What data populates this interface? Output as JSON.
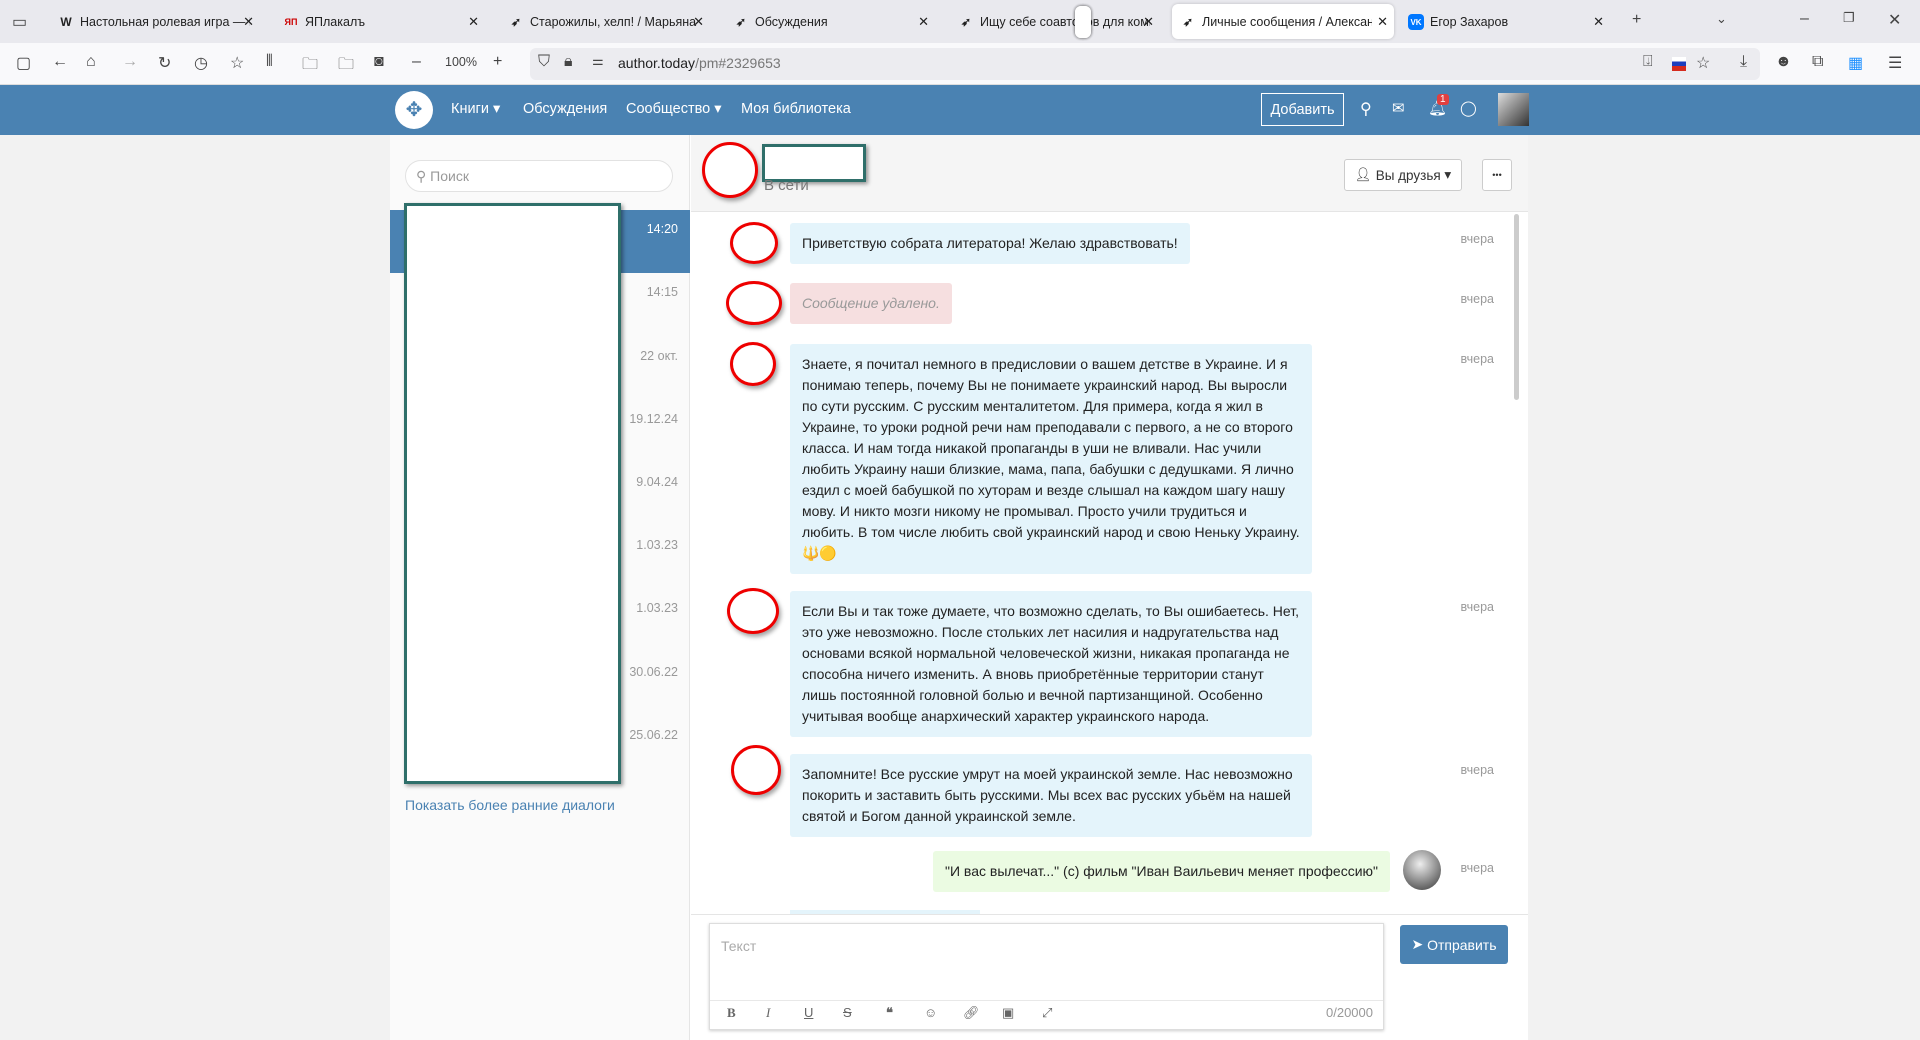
{
  "browser": {
    "tabs": [
      {
        "label": "Настольная ролевая игра — Ві",
        "icon": "W"
      },
      {
        "label": "ЯПлакалъ",
        "icon": "ЯП"
      },
      {
        "label": "Старожилы, хелп! / Марьяна Н",
        "icon": "AT"
      },
      {
        "label": "Обсуждения",
        "icon": "AT"
      },
      {
        "label": "Ищу себе соавторов для коми",
        "icon": "AT"
      },
      {
        "label": "Личные сообщения / Алексан",
        "icon": "AT"
      },
      {
        "label": "Егор Захаров",
        "icon": "VK"
      }
    ],
    "zoom": "100%",
    "url_host": "author.today",
    "url_path": "/pm#2329653"
  },
  "site": {
    "nav": [
      "Книги",
      "Обсуждения",
      "Сообщество",
      "Моя библиотека"
    ],
    "add_label": "Добавить",
    "notif_count": "1"
  },
  "sidebar": {
    "search_placeholder": "Поиск",
    "dialog_times": [
      "14:20",
      "14:15",
      "22 окт.",
      "19.12.24",
      "9.04.24",
      "1.03.23",
      "1.03.23",
      "30.06.22",
      "25.06.22"
    ],
    "show_more": "Показать более ранние диалоги"
  },
  "chat": {
    "status": "В сети",
    "friends_label": "Вы друзья",
    "more_label": "•••",
    "messages": [
      {
        "text": "Приветствую собрата литератора! Желаю здравствовать!",
        "time": "вчера"
      },
      {
        "text": "Сообщение удалено.",
        "time": "вчера"
      },
      {
        "text": "Знаете, я почитал немного в предисловии о вашем детстве в Украине. И я понимаю теперь, почему Вы не понимаете украинский народ. Вы выросли по сути русским. С русским менталитетом. Для примера, когда я жил в Украине, то уроки родной речи нам преподавали с первого, а не со второго класса. И нам тогда никакой пропаганды в уши не вливали. Нас учили любить Украину наши близкие, мама, папа, бабушки с дедушками. Я лично ездил с моей бабушкой по хуторам и везде слышал на каждом шагу нашу мову. И никто мозги никому не промывал. Просто учили трудиться и любить. В том числе любить свой украинский народ и свою Неньку Украину. 🔱🟡",
        "time": "вчера"
      },
      {
        "text": "Если Вы и так тоже думаете, что возможно сделать, то Вы ошибаетесь. Нет, это уже невозможно. После стольких лет насилия и надругательства над основами всякой нормальной человеческой жизни, никакая пропаганда не способна ничего изменить. А вновь приобретённые территории станут лишь постоянной головной болью и вечной партизанщиной. Особенно учитывая вообще анархический характер украинского народа.",
        "time": "вчера"
      },
      {
        "text": "Запомните! Все русские умрут на моей украинской земле. Нас невозможно покорить и заставить быть русскими. Мы всех вас русских убьём на нашей святой и Богом данной украинской земле.",
        "time": "вчера"
      },
      {
        "text": "\"И вас вылечат...\" (с) фильм \"Иван Ваильевич меняет профессию\"",
        "time": "вчера"
      }
    ],
    "composer": {
      "placeholder": "Текст",
      "counter": "0/20000",
      "send_label": "Отправить"
    }
  }
}
